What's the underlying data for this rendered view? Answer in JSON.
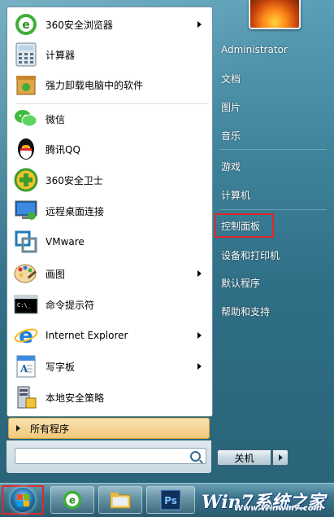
{
  "programs": [
    {
      "label": "360安全浏览器",
      "icon": "360-browser-icon",
      "has_submenu": true
    },
    {
      "label": "计算器",
      "icon": "calculator-icon",
      "has_submenu": false
    },
    {
      "label": "强力卸载电脑中的软件",
      "icon": "uninstaller-icon",
      "has_submenu": false
    },
    {
      "label": "微信",
      "icon": "wechat-icon",
      "has_submenu": false
    },
    {
      "label": "腾讯QQ",
      "icon": "qq-penguin-icon",
      "has_submenu": false
    },
    {
      "label": "360安全卫士",
      "icon": "360-safeguard-icon",
      "has_submenu": false
    },
    {
      "label": "远程桌面连接",
      "icon": "remote-desktop-icon",
      "has_submenu": false
    },
    {
      "label": "VMware",
      "icon": "vmware-icon",
      "has_submenu": false
    },
    {
      "label": "画图",
      "icon": "paint-icon",
      "has_submenu": true
    },
    {
      "label": "命令提示符",
      "icon": "command-prompt-icon",
      "has_submenu": false
    },
    {
      "label": "Internet Explorer",
      "icon": "internet-explorer-icon",
      "has_submenu": true
    },
    {
      "label": "写字板",
      "icon": "wordpad-icon",
      "has_submenu": true
    },
    {
      "label": "本地安全策略",
      "icon": "local-security-policy-icon",
      "has_submenu": false
    }
  ],
  "all_programs_label": "所有程序",
  "search": {
    "placeholder": ""
  },
  "right_menu": {
    "user": "Administrator",
    "documents": "文档",
    "pictures": "图片",
    "music": "音乐",
    "games": "游戏",
    "computer": "计算机",
    "control_panel": "控制面板",
    "devices_printers": "设备和打印机",
    "default_programs": "默认程序",
    "help_support": "帮助和支持"
  },
  "shutdown_label": "关机",
  "watermark": {
    "logo": "Win7系统之家",
    "site": "Www.Winwin7.com"
  },
  "colors": {
    "highlight": "#e0282a",
    "all_programs_bg": "#f2c878"
  }
}
